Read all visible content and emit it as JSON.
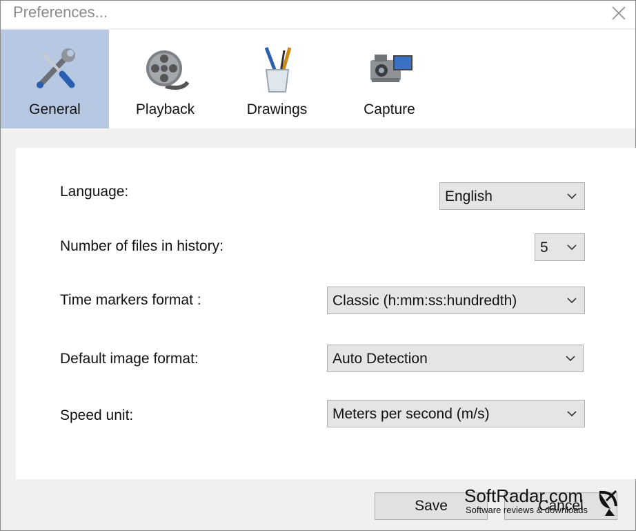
{
  "window": {
    "title": "Preferences..."
  },
  "tabs": [
    {
      "label": "General",
      "icon": "wrench-screwdriver-icon",
      "active": true
    },
    {
      "label": "Playback",
      "icon": "film-reel-icon",
      "active": false
    },
    {
      "label": "Drawings",
      "icon": "brushes-cup-icon",
      "active": false
    },
    {
      "label": "Capture",
      "icon": "camera-icon",
      "active": false
    }
  ],
  "general": {
    "language": {
      "label": "Language:",
      "value": "English"
    },
    "history": {
      "label": "Number of files in history:",
      "value": "5"
    },
    "time_markers": {
      "label": "Time markers format :",
      "value": "Classic (h:mm:ss:hundredth)"
    },
    "image_format": {
      "label": "Default image format:",
      "value": "Auto Detection"
    },
    "speed_unit": {
      "label": "Speed unit:",
      "value": "Meters per second (m/s)"
    }
  },
  "footer": {
    "save_label": "Save",
    "cancel_label": "Cancel"
  },
  "watermark": {
    "title": "SoftRadar.com",
    "subtitle": "Software reviews & downloads"
  },
  "colors": {
    "active_tab": "#b7c9e2",
    "panel": "#ffffff",
    "dialog": "#f0f0f0"
  }
}
